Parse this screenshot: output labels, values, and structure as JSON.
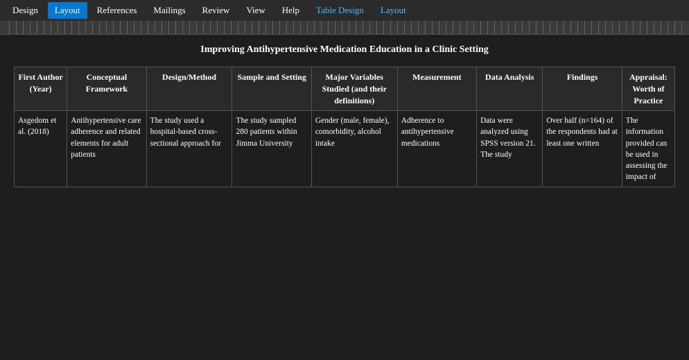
{
  "menu": {
    "items": [
      {
        "label": "Design",
        "active": false,
        "accent": false
      },
      {
        "label": "Layout",
        "active": true,
        "accent": false
      },
      {
        "label": "References",
        "active": false,
        "accent": false
      },
      {
        "label": "Mailings",
        "active": false,
        "accent": false
      },
      {
        "label": "Review",
        "active": false,
        "accent": false
      },
      {
        "label": "View",
        "active": false,
        "accent": false
      },
      {
        "label": "Help",
        "active": false,
        "accent": false
      },
      {
        "label": "Table Design",
        "active": false,
        "accent": true
      },
      {
        "label": "Layout",
        "active": false,
        "accent": true
      }
    ]
  },
  "document": {
    "title": "Improving Antihypertensive Medication Education in a Clinic Setting"
  },
  "table": {
    "headers": [
      {
        "label": "First Author (Year)",
        "class": "col-author"
      },
      {
        "label": "Conceptual Framework",
        "class": "col-framework"
      },
      {
        "label": "Design/Method",
        "class": "col-design"
      },
      {
        "label": "Sample and Setting",
        "class": "col-sample"
      },
      {
        "label": "Major Variables Studied (and their definitions)",
        "class": "col-variables"
      },
      {
        "label": "Measurement",
        "class": "col-measurement"
      },
      {
        "label": "Data Analysis",
        "class": "col-analysis"
      },
      {
        "label": "Findings",
        "class": "col-findings"
      },
      {
        "label": "Appraisal: Worth of Practice",
        "class": "col-appraisal"
      }
    ],
    "rows": [
      {
        "author": "Asgedom et al. (2018)",
        "framework": "Antihypertensive care adherence and related elements for adult patients",
        "design": "The study used a hospital-based cross-sectional approach for",
        "sample": "The study sampled 280 patients within Jimma University",
        "variables": "Gender (male, female), comorbidity, alcohol intake",
        "measurement": "Adherence to antihypertensive medications",
        "analysis": "Data were analyzed using SPSS version 21. The study",
        "findings": "Over half (n=164) of the respondents had at least one written",
        "appraisal": "The information provided can be used in assessing the impact of"
      }
    ]
  }
}
